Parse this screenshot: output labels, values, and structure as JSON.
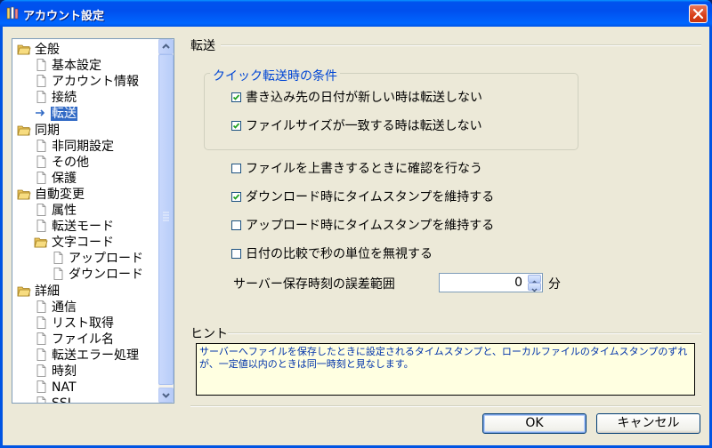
{
  "window": {
    "title": "アカウント設定"
  },
  "tree": {
    "items": [
      {
        "label": "全般",
        "icon": "folder-open-icon",
        "level": 0
      },
      {
        "label": "基本設定",
        "icon": "page-icon",
        "level": 1
      },
      {
        "label": "アカウント情報",
        "icon": "page-icon",
        "level": 1
      },
      {
        "label": "接続",
        "icon": "page-icon",
        "level": 1
      },
      {
        "label": "転送",
        "icon": "arrow-icon",
        "level": 1,
        "selected": true
      },
      {
        "label": "同期",
        "icon": "folder-open-icon",
        "level": 0
      },
      {
        "label": "非同期設定",
        "icon": "page-icon",
        "level": 1
      },
      {
        "label": "その他",
        "icon": "page-icon",
        "level": 1
      },
      {
        "label": "保護",
        "icon": "page-icon",
        "level": 1
      },
      {
        "label": "自動変更",
        "icon": "folder-open-icon",
        "level": 0
      },
      {
        "label": "属性",
        "icon": "page-icon",
        "level": 1
      },
      {
        "label": "転送モード",
        "icon": "page-icon",
        "level": 1
      },
      {
        "label": "文字コード",
        "icon": "folder-open-icon",
        "level": 1
      },
      {
        "label": "アップロード",
        "icon": "page-icon",
        "level": 2
      },
      {
        "label": "ダウンロード",
        "icon": "page-icon",
        "level": 2
      },
      {
        "label": "詳細",
        "icon": "folder-open-icon",
        "level": 0
      },
      {
        "label": "通信",
        "icon": "page-icon",
        "level": 1
      },
      {
        "label": "リスト取得",
        "icon": "page-icon",
        "level": 1
      },
      {
        "label": "ファイル名",
        "icon": "page-icon",
        "level": 1
      },
      {
        "label": "転送エラー処理",
        "icon": "page-icon",
        "level": 1
      },
      {
        "label": "時刻",
        "icon": "page-icon",
        "level": 1
      },
      {
        "label": "NAT",
        "icon": "page-icon",
        "level": 1
      },
      {
        "label": "SSL",
        "icon": "page-icon",
        "level": 1
      }
    ]
  },
  "section": {
    "title": "転送"
  },
  "quick_group": {
    "title": "クイック転送時の条件",
    "options": [
      {
        "label": "書き込み先の日付が新しい時は転送しない",
        "checked": true
      },
      {
        "label": "ファイルサイズが一致する時は転送しない",
        "checked": true
      }
    ]
  },
  "options": [
    {
      "label": "ファイルを上書きするときに確認を行なう",
      "checked": false
    },
    {
      "label": "ダウンロード時にタイムスタンプを維持する",
      "checked": true
    },
    {
      "label": "アップロード時にタイムスタンプを維持する",
      "checked": false
    },
    {
      "label": "日付の比較で秒の単位を無視する",
      "checked": false
    }
  ],
  "time_error": {
    "label": "サーバー保存時刻の誤差範囲",
    "value": "0",
    "unit": "分"
  },
  "hint": {
    "title": "ヒント",
    "text": "サーバーへファイルを保存したときに設定されるタイムスタンプと、ローカルファイルのタイムスタンプのずれが、一定値以内のときは同一時刻と見なします。"
  },
  "buttons": {
    "ok": "OK",
    "cancel": "キャンセル"
  },
  "colors": {
    "title_bar": "#0054e3",
    "selection": "#316ac5",
    "group_title": "#0046d5",
    "hint_bg": "#ffffe1"
  }
}
